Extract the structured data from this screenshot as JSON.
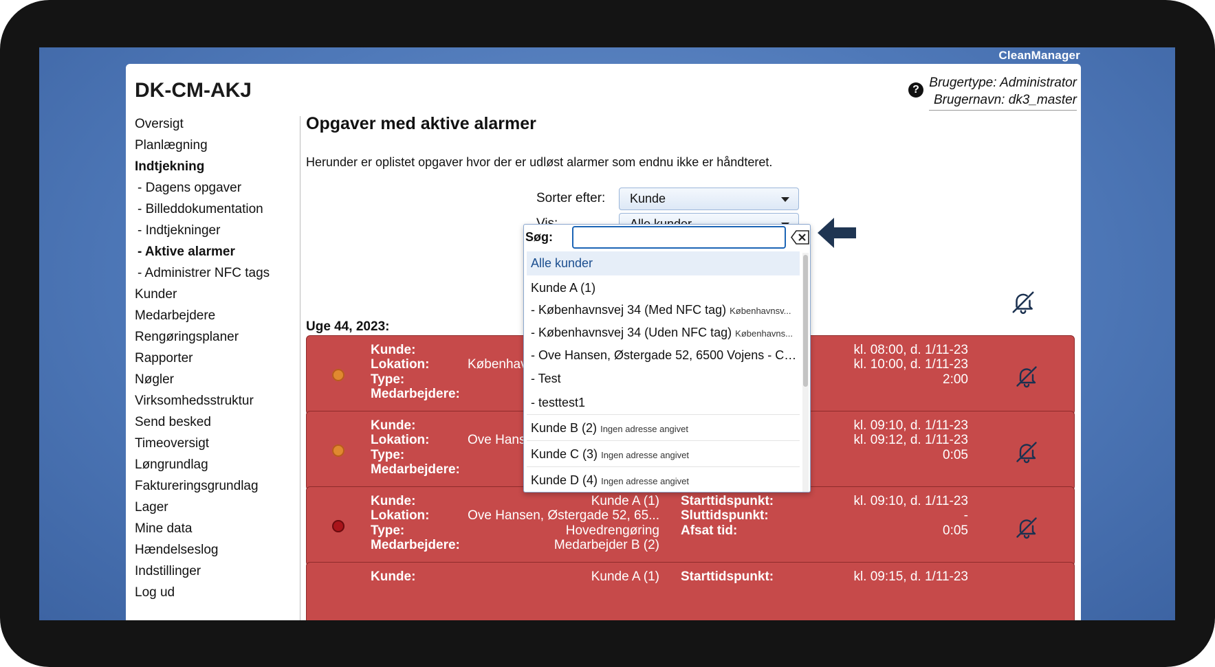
{
  "brand": "CleanManager",
  "header": {
    "title": "DK-CM-AKJ",
    "user_type": "Brugertype: Administrator",
    "user_name": "Brugernavn: dk3_master"
  },
  "sidebar": {
    "items": [
      {
        "label": "Oversigt"
      },
      {
        "label": "Planlægning"
      },
      {
        "label": "Indtjekning"
      },
      {
        "label": "- Dagens opgaver"
      },
      {
        "label": "- Billeddokumentation"
      },
      {
        "label": "- Indtjekninger"
      },
      {
        "label": "- Aktive alarmer"
      },
      {
        "label": "- Administrer NFC tags"
      },
      {
        "label": "Kunder"
      },
      {
        "label": "Medarbejdere"
      },
      {
        "label": "Rengøringsplaner"
      },
      {
        "label": "Rapporter"
      },
      {
        "label": "Nøgler"
      },
      {
        "label": "Virksomhedsstruktur"
      },
      {
        "label": "Send besked"
      },
      {
        "label": "Timeoversigt"
      },
      {
        "label": "Løngrundlag"
      },
      {
        "label": "Faktureringsgrundlag"
      },
      {
        "label": "Lager"
      },
      {
        "label": "Mine data"
      },
      {
        "label": "Hændelseslog"
      },
      {
        "label": "Indstillinger"
      },
      {
        "label": "Log ud"
      }
    ]
  },
  "main": {
    "title": "Opgaver med aktive alarmer",
    "intro": "Herunder er oplistet opgaver hvor der er udløst alarmer som endnu ikke er håndteret.",
    "sort_label": "Sorter efter:",
    "sort_value": "Kunde",
    "show_label": "Vis:",
    "show_value": "Alle kunder",
    "week_label": "Uge 44, 2023:"
  },
  "labels": {
    "kunde": "Kunde:",
    "lokation": "Lokation:",
    "type": "Type:",
    "medarbejdere": "Medarbejdere:",
    "start": "Starttidspunkt:",
    "slut": "Sluttidspunkt:",
    "afsat": "Afsat tid:"
  },
  "alarms": [
    {
      "kunde": "",
      "lokation": "Københav",
      "type": "",
      "medarbejdere": "",
      "start": "kl. 08:00, d. 1/11-23",
      "slut": "kl. 10:00, d. 1/11-23",
      "afsat": "2:00",
      "status_color": "#e0892f"
    },
    {
      "kunde": "",
      "lokation": "Ove Hans",
      "type": "",
      "medarbejdere": "",
      "start": "kl. 09:10, d. 1/11-23",
      "slut": "kl. 09:12, d. 1/11-23",
      "afsat": "0:05",
      "status_color": "#e0892f"
    },
    {
      "kunde": "Kunde A (1)",
      "lokation": "Ove Hansen, Østergade 52, 65...",
      "type": "Hovedrengøring",
      "medarbejdere": "Medarbejder B (2)",
      "start": "kl. 09:10, d. 1/11-23",
      "slut": "-",
      "afsat": "0:05",
      "status_color": "#a9141a"
    },
    {
      "kunde": "Kunde A (1)",
      "start": "kl. 09:15, d. 1/11-23"
    }
  ],
  "dropdown": {
    "search_label": "Søg:",
    "search_value": "",
    "items": [
      {
        "label": "Alle kunder",
        "note": ""
      },
      {
        "label": "Kunde A (1)",
        "note": ""
      },
      {
        "label": "- Københavnsvej 34 (Med NFC tag)",
        "note": "Københavnsv..."
      },
      {
        "label": "- Københavnsvej 34 (Uden NFC tag)",
        "note": "Københavns..."
      },
      {
        "label": "- Ove Hansen, Østergade 52, 6500 Vojens - CP...",
        "note": ""
      },
      {
        "label": "- Test",
        "note": ""
      },
      {
        "label": "- testtest1",
        "note": ""
      },
      {
        "label": "Kunde B (2)",
        "note": "Ingen adresse angivet"
      },
      {
        "label": "Kunde C (3)",
        "note": "Ingen adresse angivet"
      },
      {
        "label": "Kunde D (4)",
        "note": "Ingen adresse angivet"
      }
    ]
  },
  "colors": {
    "alarm_bg": "#c64a4a",
    "desktop_blue": "#4f79b9",
    "accent": "#1b64b5"
  },
  "icons": [
    "help-icon",
    "bell-off-icon",
    "arrow-left-icon",
    "clear-input-icon",
    "caret-down-icon"
  ]
}
